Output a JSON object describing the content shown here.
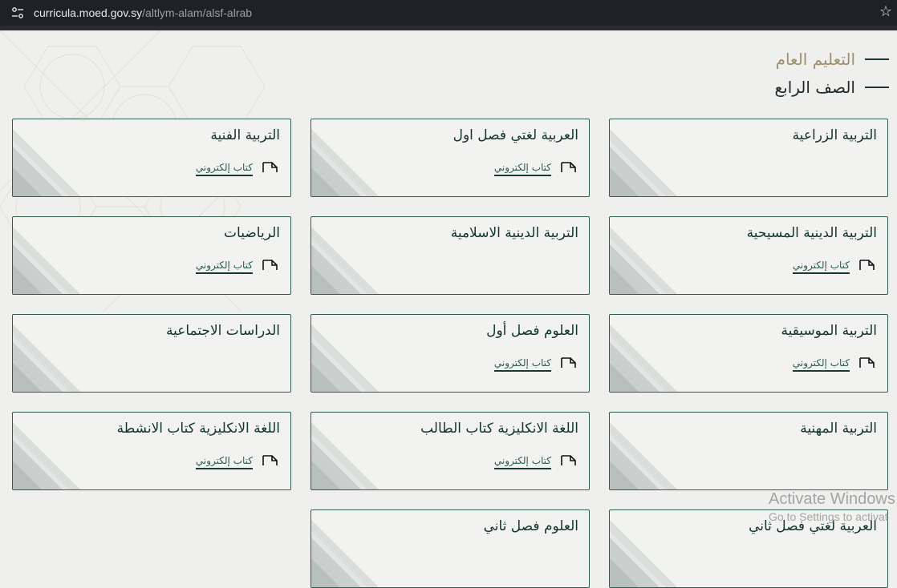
{
  "browser": {
    "url_host": "curricula.moed.gov.sy",
    "url_path": "/altlym-alam/alsf-alrab",
    "site_info_icon": "tune-icon",
    "bookmark_icon": "star-icon"
  },
  "breadcrumb": {
    "level1": "التعليم العام",
    "level2": "الصف الرابع"
  },
  "colors": {
    "primary": "#11352e",
    "gold": "#a08f6c",
    "border": "#2f5c4f",
    "link": "#2c5c50"
  },
  "pdf_label": "كتاب إلكتروني",
  "pdf_icon": "pdf-icon",
  "subjects": [
    {
      "title": "التربية الزراعية",
      "has_pdf": false
    },
    {
      "title": "العربية لغتي فصل اول",
      "has_pdf": true
    },
    {
      "title": "التربية الفنية",
      "has_pdf": true
    },
    {
      "title": "التربية الدينية المسيحية",
      "has_pdf": true
    },
    {
      "title": "التربية الدينية الاسلامية",
      "has_pdf": false
    },
    {
      "title": "الرياضيات",
      "has_pdf": true
    },
    {
      "title": "التربية الموسيقية",
      "has_pdf": true
    },
    {
      "title": "العلوم فصل أول",
      "has_pdf": true
    },
    {
      "title": "الدراسات الاجتماعية",
      "has_pdf": false
    },
    {
      "title": "التربية المهنية",
      "has_pdf": false
    },
    {
      "title": "اللغة الانكليزية كتاب الطالب",
      "has_pdf": true
    },
    {
      "title": "اللغة الانكليزية كتاب الانشطة",
      "has_pdf": true
    },
    {
      "title": "العربية لغتي فصل ثاني",
      "has_pdf": false
    },
    {
      "title": "العلوم فصل ثاني",
      "has_pdf": false
    }
  ],
  "watermark": {
    "line1": "Activate Windows",
    "line2": "Go to Settings to activat"
  }
}
